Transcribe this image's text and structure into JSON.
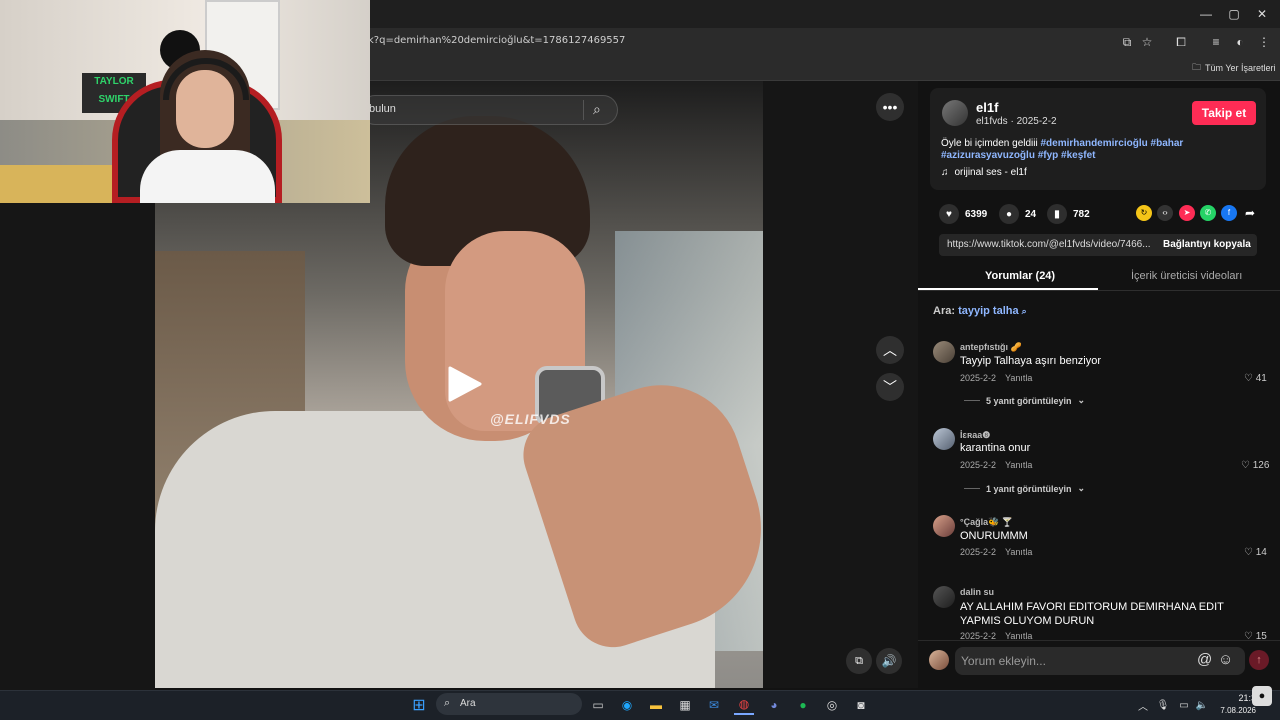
{
  "browser": {
    "url": "k?q=demirhan%20demircioğlu&t=1786127469557",
    "bookmarks_label": "Tüm Yer İşaretleri"
  },
  "video": {
    "search_placeholder": "bulun",
    "watermark": "@ELIFVDS"
  },
  "post": {
    "display_name": "el1f",
    "handle_date": "el1fvds · 2025-2-2",
    "follow_label": "Takip et",
    "caption_text": "Öyle bi içimden geldiii",
    "caption_tags_line1": "#demirhandemircioğlu #bahar",
    "caption_tags_line2": "#azizurasyavuzoğlu #fyp #keşfet",
    "sound": "orijinal ses - el1f",
    "likes": "6399",
    "comments": "24",
    "saves": "782",
    "link": "https://www.tiktok.com/@el1fvds/video/7466...",
    "copy_link_label": "Bağlantıyı kopyala"
  },
  "tabs": {
    "comments": "Yorumlar (24)",
    "creator_videos": "İçerik üreticisi videoları"
  },
  "search_hint": {
    "prefix": "Ara:",
    "query": "tayyip talha"
  },
  "comments": [
    {
      "user": "antepfıstığı 🥜",
      "text": "Tayyip Talhaya aşırı benziyor",
      "date": "2025-2-2",
      "reply": "Yanıtla",
      "likes": "41",
      "replies": "5 yanıt görüntüleyin"
    },
    {
      "user": "İɛʀaa❽",
      "text": "karantina onur",
      "date": "2025-2-2",
      "reply": "Yanıtla",
      "likes": "126",
      "replies": "1 yanıt görüntüleyin"
    },
    {
      "user": "°Çağla🐝 🍸",
      "text": "ONURUMMM",
      "date": "2025-2-2",
      "reply": "Yanıtla",
      "likes": "14"
    },
    {
      "user": "dalin su",
      "text": "AY ALLAHIM FAVORI EDITORUM DEMIRHANA EDIT YAPMIS OLUYOM DURUN",
      "date": "2025-2-2",
      "reply": "Yanıtla",
      "likes": "15"
    }
  ],
  "comment_input_placeholder": "Yorum ekleyin...",
  "taskbar": {
    "search_label": "Ara",
    "time": "21:3",
    "date": "7.08.2026"
  },
  "colors": {
    "follow": "#fe2c55",
    "hashtag": "#8fb7ff"
  }
}
